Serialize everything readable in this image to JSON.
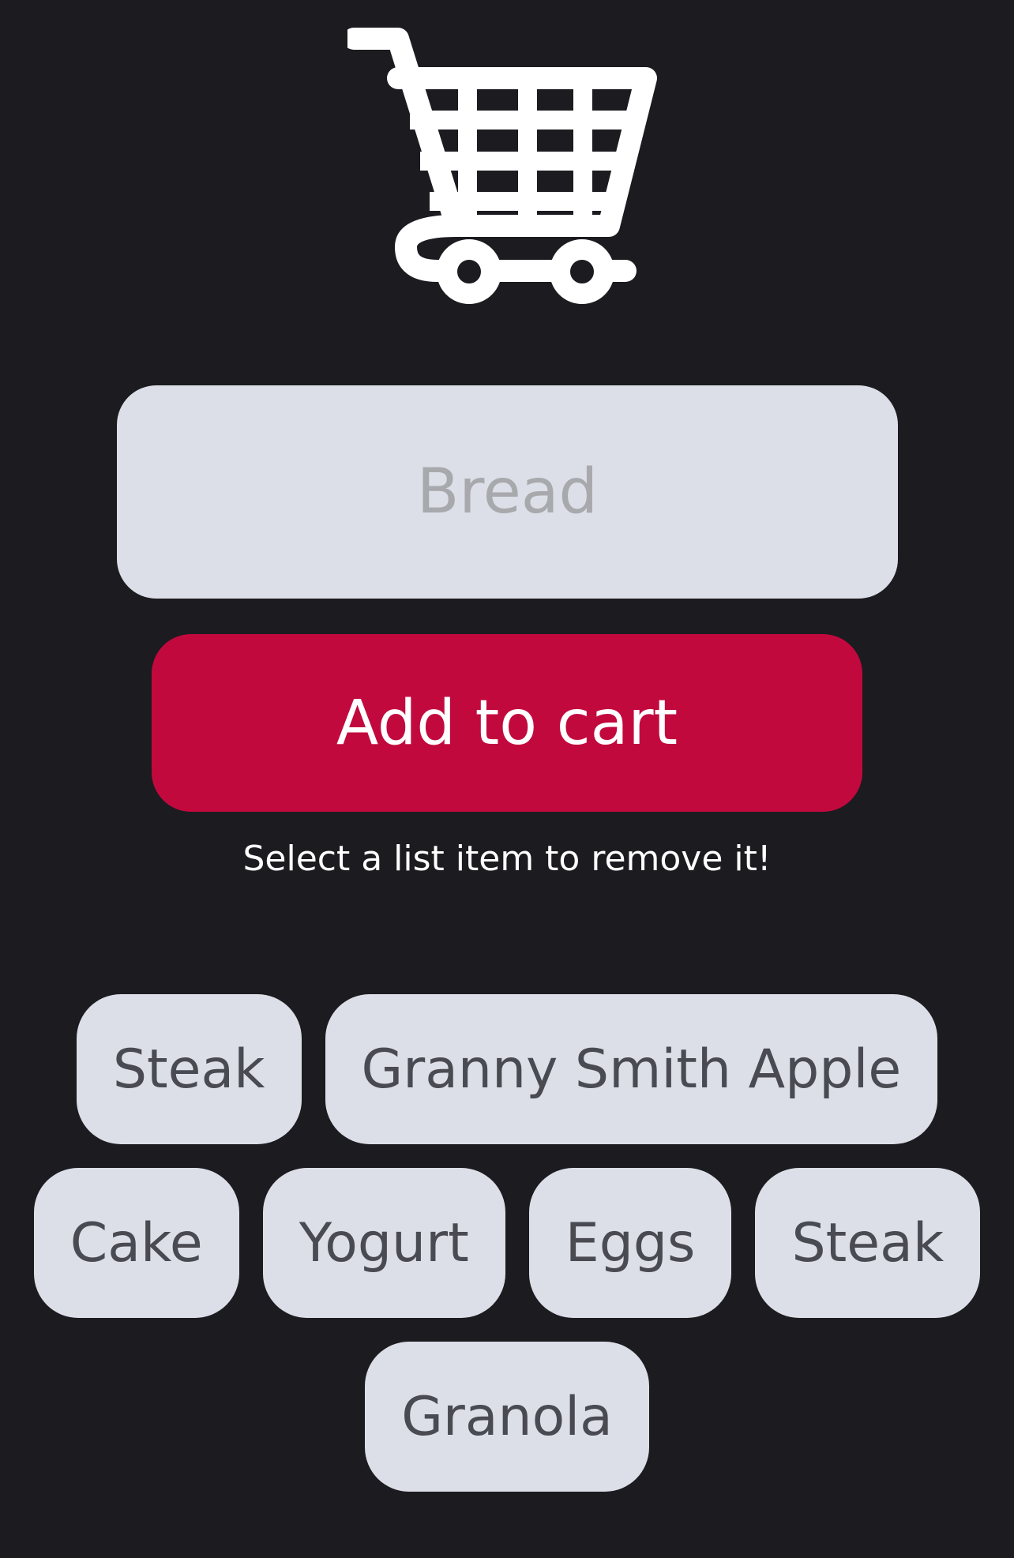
{
  "header": {
    "icon": "shopping-cart-icon"
  },
  "input": {
    "placeholder": "Bread",
    "value": ""
  },
  "add_button": {
    "label": "Add to cart",
    "color": "#c2093e"
  },
  "hint": "Select a list item to remove it!",
  "items": [
    "Steak",
    "Granny Smith Apple",
    "Cake",
    "Yogurt",
    "Eggs",
    "Steak",
    "Granola"
  ],
  "colors": {
    "background": "#1c1b20",
    "surface": "#dcdfe8",
    "accent": "#c2093e"
  }
}
